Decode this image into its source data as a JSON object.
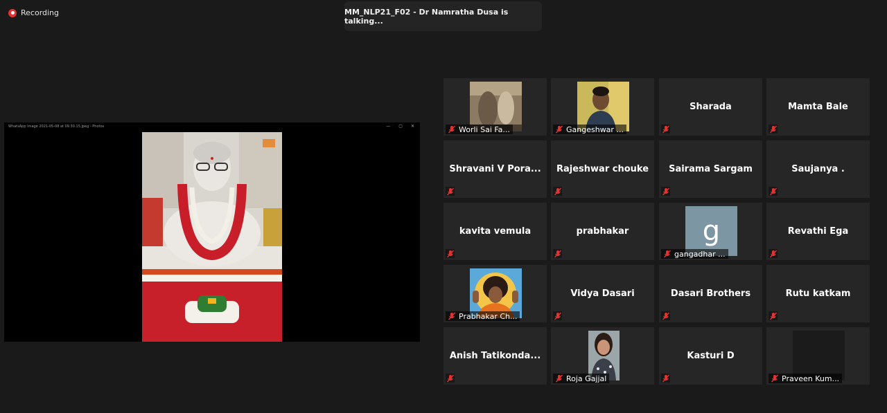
{
  "recording": {
    "label": "Recording"
  },
  "speaker_banner": {
    "text": "MM_NLP21_F02 - Dr Namratha Dusa is talking..."
  },
  "shared_window": {
    "title": "WhatsApp Image 2021-05-08 at 09.30.15.jpeg - Photos"
  },
  "participants": [
    {
      "name": "Worli Sai Fa..."
    },
    {
      "name": "Gangeshwar ..."
    },
    {
      "name": "Sharada"
    },
    {
      "name": "Mamta Bale"
    },
    {
      "name": "Shravani  V  Pora..."
    },
    {
      "name": "Rajeshwar chouke"
    },
    {
      "name": "Sairama Sargam"
    },
    {
      "name": "Saujanya ."
    },
    {
      "name": "kavita vemula"
    },
    {
      "name": "prabhakar"
    },
    {
      "name": "gangadhar ...",
      "avatar_letter": "g"
    },
    {
      "name": "Revathi Ega"
    },
    {
      "name": "Prabhakar Ch..."
    },
    {
      "name": "Vidya Dasari"
    },
    {
      "name": "Dasari Brothers"
    },
    {
      "name": "Rutu katkam"
    },
    {
      "name": "Anish  Tatikonda..."
    },
    {
      "name": "Roja Gajjal"
    },
    {
      "name": "Kasturi D"
    },
    {
      "name": "Praveen Kum..."
    }
  ],
  "colors": {
    "background": "#1a1a1a",
    "tile": "#262626",
    "muted_mic": "#e5312f",
    "recording": "#e5312f"
  }
}
